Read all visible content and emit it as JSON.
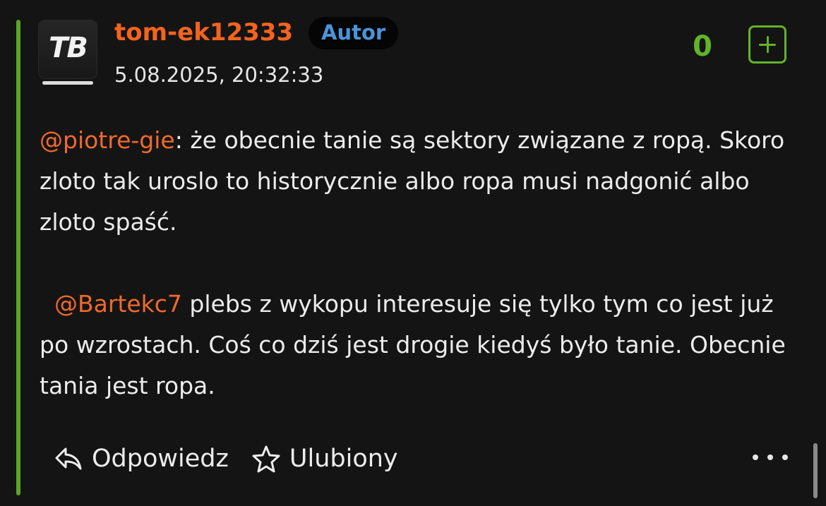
{
  "comment": {
    "avatar_text": "TB",
    "username": "tom-ek12333",
    "badge": "Autor",
    "timestamp": "5.08.2025, 20:32:33",
    "vote_count": "0",
    "paragraphs": [
      {
        "mention": "@piotre-gie",
        "text": ": że obecnie tanie są sektory związane z ropą. Skoro zloto tak uroslo to historycznie albo ropa musi nadgonić albo zloto spaść."
      },
      {
        "mention": "@Bartekc7",
        "text": " plebs z wykopu interesuje się tylko tym co jest już po wzrostach. Coś co dziś jest drogie kiedyś było tanie. Obecnie tania jest ropa."
      }
    ]
  },
  "actions": {
    "reply_label": "Odpowiedz",
    "favorite_label": "Ulubiony"
  },
  "icons": {
    "reply": "reply-icon",
    "favorite": "star-icon",
    "more": "more-dots-icon",
    "upvote": "plus-square-icon"
  },
  "colors": {
    "background": "#141414",
    "thread_bar": "#5aa426",
    "username": "#f2641e",
    "mention": "#ef6a2c",
    "badge_text": "#4b94d8",
    "vote": "#62b32a",
    "text": "#ececec"
  }
}
